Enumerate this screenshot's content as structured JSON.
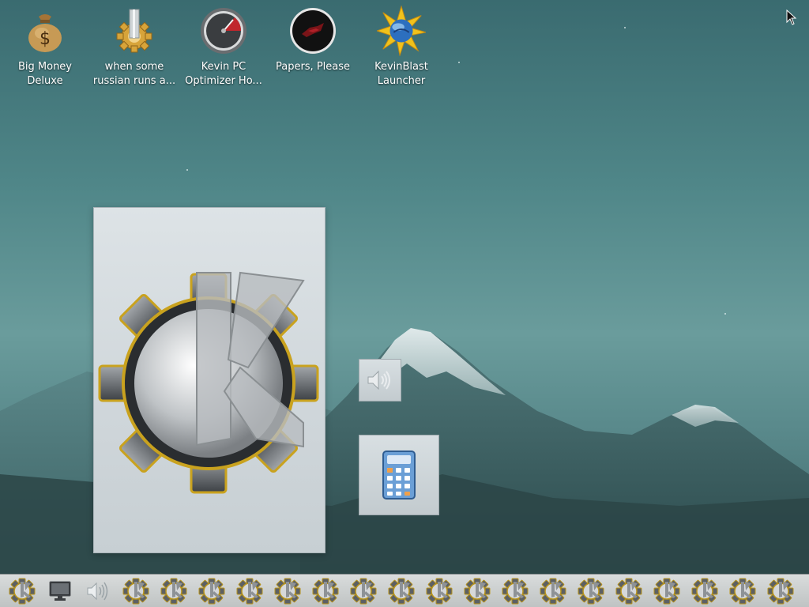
{
  "desktop": {
    "icons": [
      {
        "label": "Big Money\nDeluxe",
        "icon": "money-bag-icon"
      },
      {
        "label": "when some\nrussian runs a...",
        "icon": "gear-pipe-icon"
      },
      {
        "label": "Kevin PC\nOptimizer Ho...",
        "icon": "speedometer-icon"
      },
      {
        "label": "Papers, Please",
        "icon": "papers-please-icon"
      },
      {
        "label": "KevinBlast\nLauncher",
        "icon": "kevinblast-icon"
      }
    ]
  },
  "windows": {
    "main_icon": "kde-gear-logo-icon",
    "volume_icon": "speaker-icon",
    "calculator_icon": "calculator-icon"
  },
  "taskbar": {
    "item_count": 21,
    "items": [
      "kde-gear",
      "monitor",
      "speaker",
      "kde-gear",
      "kde-gear",
      "kde-gear",
      "kde-gear",
      "kde-gear",
      "kde-gear",
      "kde-gear",
      "kde-gear",
      "kde-gear",
      "kde-gear",
      "kde-gear",
      "kde-gear",
      "kde-gear",
      "kde-gear",
      "kde-gear",
      "kde-gear",
      "kde-gear",
      "kde-gear"
    ]
  },
  "colors": {
    "sky_top": "#3a6b70",
    "mountain_snow": "#dfe9ea",
    "mountain_dark": "#2f4f52",
    "taskbar_bg": "#c9cccc"
  }
}
